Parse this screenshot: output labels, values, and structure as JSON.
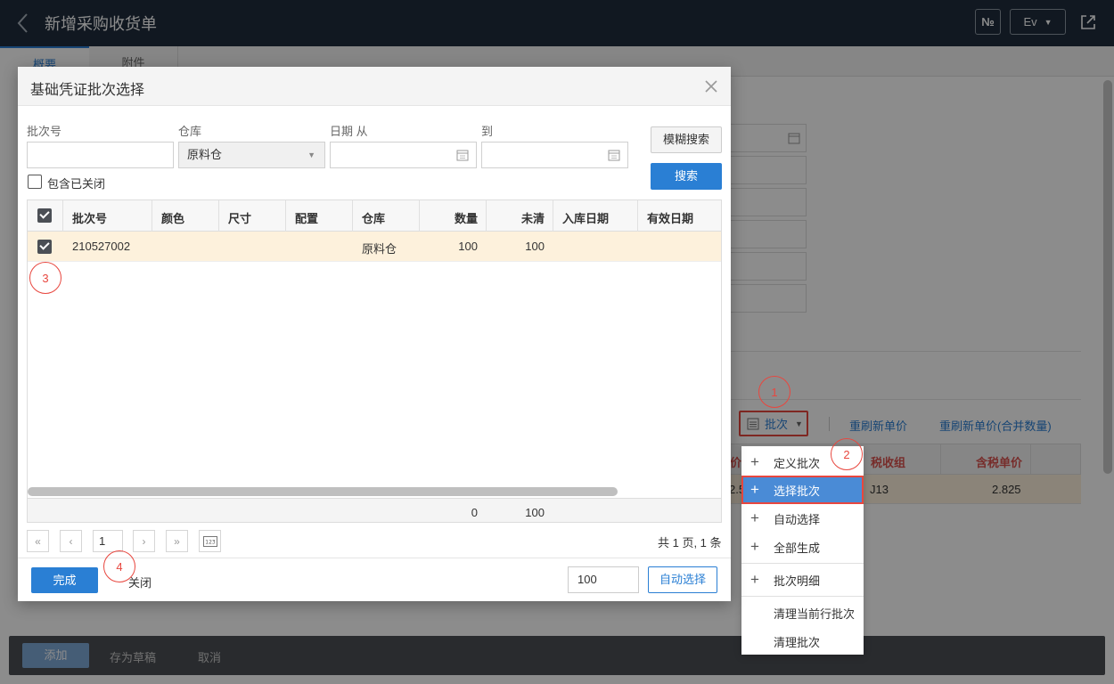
{
  "header": {
    "title": "新增采购收货单",
    "no_label": "№",
    "lang_label": "Ev"
  },
  "tabs": [
    {
      "label": "概要"
    },
    {
      "label": "附件"
    }
  ],
  "toolbar": {
    "batch_label": "批次",
    "refresh_price": "重刷新单价",
    "refresh_price_merge": "重刷新单价(合并数量)"
  },
  "bg_grid": {
    "headers": {
      "price_partial": "价",
      "tax_group": "税收组",
      "tax_price": "含税单价"
    },
    "row": {
      "price_partial": "2.5",
      "tax_group": "J13",
      "tax_price": "2.825"
    }
  },
  "batch_menu": {
    "items": [
      {
        "label": "定义批次"
      },
      {
        "label": "选择批次"
      },
      {
        "label": "自动选择"
      },
      {
        "label": "全部生成"
      },
      {
        "label": "批次明细"
      },
      {
        "label": "清理当前行批次"
      },
      {
        "label": "清理批次"
      }
    ]
  },
  "footer": {
    "add": "添加",
    "save_draft": "存为草稿",
    "cancel": "取消"
  },
  "dialog": {
    "title": "基础凭证批次选择",
    "filters": {
      "batch_no_label": "批次号",
      "batch_no_value": "",
      "warehouse_label": "仓库",
      "warehouse_value": "原料仓",
      "date_from_label": "日期 从",
      "date_to_label": "到",
      "include_closed_label": "包含已关闭"
    },
    "buttons": {
      "fuzzy_search": "模糊搜索",
      "search": "搜索",
      "done": "完成",
      "close": "关闭",
      "auto_select": "自动选择"
    },
    "table": {
      "columns": [
        "批次号",
        "颜色",
        "尺寸",
        "配置",
        "仓库",
        "数量",
        "未清",
        "入库日期",
        "有效日期"
      ],
      "rows": [
        {
          "batch_no": "210527002",
          "color": "",
          "size": "",
          "config": "",
          "warehouse": "原料仓",
          "qty": "100",
          "open": "100",
          "in_date": "",
          "exp_date": ""
        }
      ],
      "totals": {
        "qty": "0",
        "open": "100"
      }
    },
    "pagination": {
      "page": "1",
      "info": "共 1 页, 1 条"
    },
    "qty_value": "100"
  },
  "annotations": [
    "1",
    "2",
    "3",
    "4"
  ]
}
